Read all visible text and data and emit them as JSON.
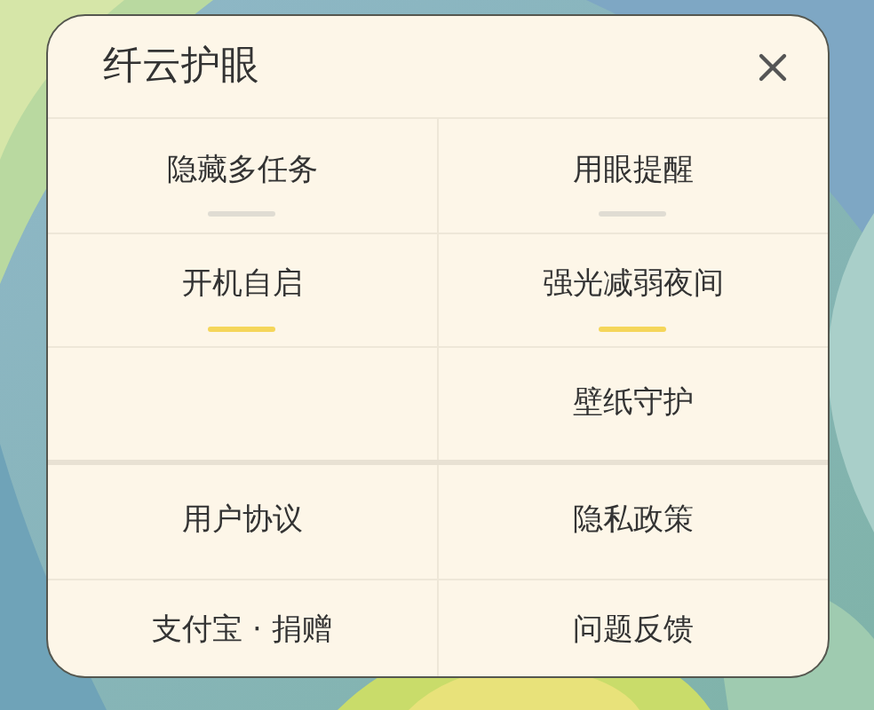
{
  "dialog": {
    "title": "纤云护眼"
  },
  "sections": [
    {
      "items": [
        {
          "kind": "toggle",
          "label": "隐藏多任务",
          "on": false
        },
        {
          "kind": "toggle",
          "label": "用眼提醒",
          "on": false
        },
        {
          "kind": "toggle",
          "label": "开机自启",
          "on": true
        },
        {
          "kind": "toggle",
          "label": "强光减弱夜间",
          "on": true
        },
        {
          "kind": "empty"
        },
        {
          "kind": "action",
          "label": "壁纸守护"
        }
      ]
    },
    {
      "items": [
        {
          "kind": "link",
          "label": "用户协议"
        },
        {
          "kind": "link",
          "label": "隐私政策"
        },
        {
          "kind": "link",
          "label": "支付宝 · 捐赠"
        },
        {
          "kind": "link",
          "label": "问题反馈"
        }
      ]
    }
  ]
}
